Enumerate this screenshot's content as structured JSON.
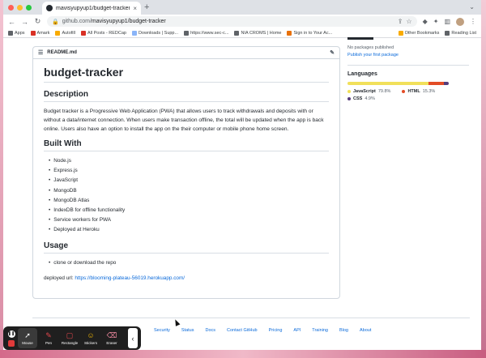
{
  "browser": {
    "tab_title": "mavisyupyup1/budget-tracker",
    "tab_close": "×",
    "new_tab": "+",
    "url_host": "github.com/",
    "url_path": "mavisyupyup1/budget-tracker"
  },
  "bookmarks": [
    {
      "label": "Apps",
      "icon": "grid-icon"
    },
    {
      "label": "Amark",
      "icon": "bookmark-icon"
    },
    {
      "label": "Autofill",
      "icon": "bookmark-icon"
    },
    {
      "label": "All Posts - REDCap",
      "icon": "bookmark-icon"
    },
    {
      "label": "Downloads | Supp...",
      "icon": "bookmark-icon"
    },
    {
      "label": "https://www.sec-c...",
      "icon": "bookmark-icon"
    },
    {
      "label": "NIA CROMS | Home",
      "icon": "bookmark-icon"
    },
    {
      "label": "Sign in to Your Ac...",
      "icon": "bookmark-icon"
    }
  ],
  "bookmarks_right": {
    "other": "Other Bookmarks",
    "reading": "Reading List"
  },
  "readme": {
    "filename": "README.md",
    "title": "budget-tracker",
    "description_heading": "Description",
    "description": "Budget tracker is a Progressive Web Application (PWA) that allows users to track withdrawals and deposits with or without a data/internet connection. When users make transaction offline, the total will be updated when the app is back online. Users also have an option to install the app on the their computer or mobile phone home screen.",
    "built_heading": "Built With",
    "built_with": [
      "Node.js",
      "Express.js",
      "JavaScript",
      "MongoDB",
      "MongoDB Atlas",
      "IndexDB for offline functionality",
      "Service workers for PWA",
      "Deployed at Heroku"
    ],
    "usage_heading": "Usage",
    "usage": [
      "clone or download the repo"
    ],
    "deployed_label": "deployed url: ",
    "deployed_url": "https://blooming-plateau-56019.herokuapp.com/"
  },
  "sidebar": {
    "packages_text": "No packages published",
    "packages_link": "Publish your first package",
    "languages_heading": "Languages",
    "languages": [
      {
        "name": "JavaScript",
        "percent": "79.8%",
        "value": 79.8,
        "color": "#f1e05a"
      },
      {
        "name": "HTML",
        "percent": "15.3%",
        "value": 15.3,
        "color": "#e34c26"
      },
      {
        "name": "CSS",
        "percent": "4.9%",
        "value": 4.9,
        "color": "#563d7c"
      }
    ]
  },
  "footer": {
    "links": [
      "Security",
      "Status",
      "Docs",
      "Contact GitHub",
      "Pricing",
      "API",
      "Training",
      "Blog",
      "About"
    ]
  },
  "annotation_toolbar": {
    "tools": [
      {
        "label": "Mouse",
        "icon": "cursor-icon",
        "glyph": "➚",
        "active": true
      },
      {
        "label": "Pen",
        "icon": "pen-icon",
        "glyph": "✎",
        "active": false
      },
      {
        "label": "Rectangle",
        "icon": "rectangle-icon",
        "glyph": "▢",
        "active": false
      },
      {
        "label": "Stickers",
        "icon": "sticker-icon",
        "glyph": "☺",
        "active": false
      },
      {
        "label": "Eraser",
        "icon": "eraser-icon",
        "glyph": "⌫",
        "active": false
      }
    ],
    "collapse_glyph": "‹"
  }
}
